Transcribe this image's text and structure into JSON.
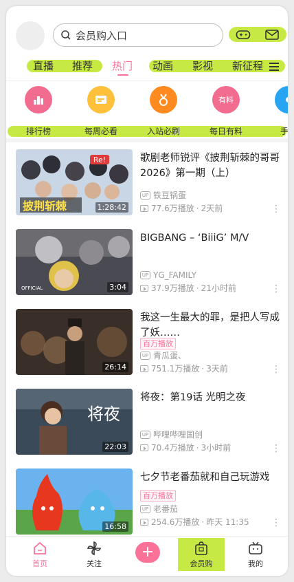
{
  "colors": {
    "accent": "#fb7299",
    "highlight": "#c6ea43"
  },
  "header": {
    "search_placeholder": "会员购入口",
    "icons": [
      "gamepad-icon",
      "mail-icon"
    ]
  },
  "tabs": [
    {
      "label": "直播"
    },
    {
      "label": "推荐"
    },
    {
      "label": "热门"
    },
    {
      "label": "动画"
    },
    {
      "label": "影视"
    },
    {
      "label": "新征程"
    }
  ],
  "categories": [
    {
      "label": "排行榜",
      "icon": "bar-chart-icon",
      "color": "#f26c90"
    },
    {
      "label": "每周必看",
      "icon": "weekly-icon",
      "color": "#ffc13b"
    },
    {
      "label": "入站必刷",
      "icon": "medal-icon",
      "color": "#ff8a1f"
    },
    {
      "label": "每日有料",
      "icon": "daily-icon",
      "color": "#f26c90"
    },
    {
      "label": "手游",
      "icon": "game-icon",
      "color": "#27a4f2"
    }
  ],
  "feed": [
    {
      "title": "歌剧老师锐评《披荆斩棘的哥哥2026》第一期（上）",
      "badge": "",
      "uploader": "铁豆锅蛋",
      "views": "77.6万播放",
      "time": "2天前",
      "duration": "1:28:42",
      "thumb_text": "披荆斩棘"
    },
    {
      "title": "BIGBANG – ‘BiiiG’ M/V",
      "badge": "",
      "uploader": "YG_FAMILY",
      "views": "37.9万播放",
      "time": "21小时前",
      "duration": "3:04",
      "thumb_text": "OFFICIAL"
    },
    {
      "title": "我这一生最大的罪，是把人写成了妖……",
      "badge": "百万播放",
      "uploader": "青瓜蛋、",
      "views": "751.1万播放",
      "time": "3天前",
      "duration": "26:14",
      "thumb_text": ""
    },
    {
      "title": "将夜：第19话 光明之夜",
      "badge": "",
      "uploader": "哔哩哔哩国创",
      "views": "70.4万播放",
      "time": "3小时前",
      "duration": "22:03",
      "thumb_text": "将夜"
    },
    {
      "title": "七夕节老番茄就和自己玩游戏",
      "badge": "百万播放",
      "uploader": "老番茄",
      "views": "254.6万播放",
      "time": "昨天 11:35",
      "duration": "16:58",
      "thumb_text": ""
    }
  ],
  "bottom_nav": [
    {
      "label": "首页",
      "icon": "home-icon"
    },
    {
      "label": "关注",
      "icon": "pinwheel-icon"
    },
    {
      "label": "+",
      "icon": "plus-icon"
    },
    {
      "label": "会员购",
      "icon": "shop-bag-icon"
    },
    {
      "label": "我的",
      "icon": "tv-icon"
    }
  ]
}
